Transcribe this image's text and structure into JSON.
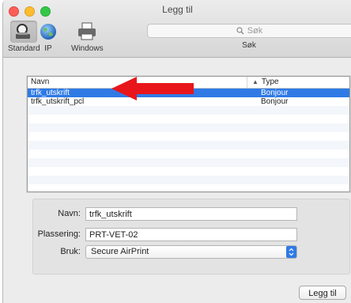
{
  "window": {
    "title": "Legg til"
  },
  "toolbar": {
    "standard_label": "Standard",
    "ip_label": "IP",
    "windows_label": "Windows",
    "search_placeholder": "Søk",
    "search_caption": "Søk"
  },
  "list": {
    "columns": {
      "name": "Navn",
      "type": "Type"
    },
    "rows": [
      {
        "name": "trfk_utskrift",
        "type": "Bonjour",
        "selected": true
      },
      {
        "name": "trfk_utskrift_pcl",
        "type": "Bonjour",
        "selected": false
      }
    ]
  },
  "details": {
    "name_label": "Navn:",
    "name_value": "trfk_utskrift",
    "location_label": "Plassering:",
    "location_value": "PRT-VET-02",
    "use_label": "Bruk:",
    "use_value": "Secure AirPrint"
  },
  "actions": {
    "add_label": "Legg til"
  },
  "colors": {
    "selection": "#2f7ae5",
    "annotation_arrow": "#e8161b"
  }
}
